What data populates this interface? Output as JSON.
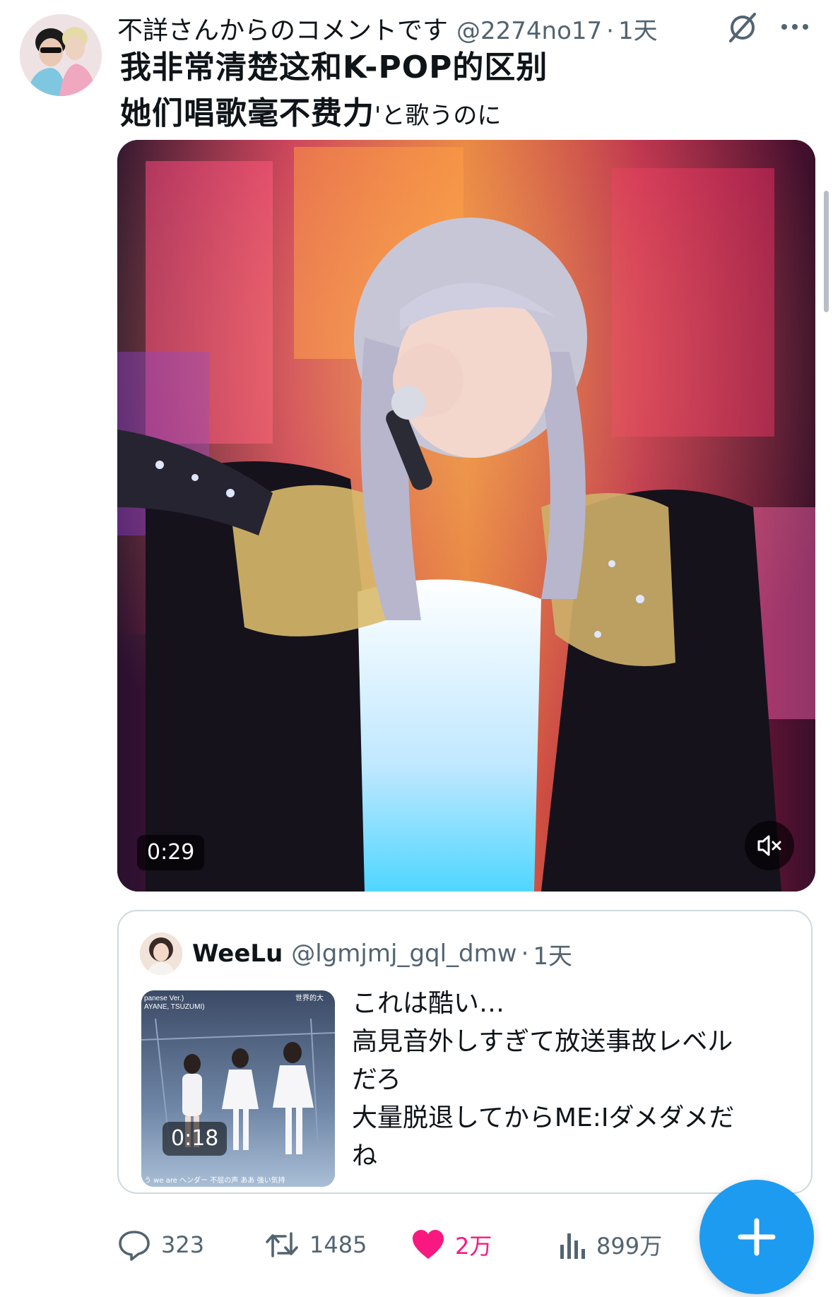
{
  "tweet": {
    "author_name": "不詳さんからのコメントです",
    "handle": "@2274no17",
    "separator": "·",
    "time": "1天",
    "text_line1": "我非常清楚这和K-POP的区别",
    "text_line2": "她们唱歌毫不费力",
    "text_line2_suffix": "'と歌うのに",
    "video": {
      "duration": "0:29",
      "muted": true
    }
  },
  "quote": {
    "author_name": "WeeLu",
    "handle": "@lgmjmj_gql_dmw",
    "separator": "·",
    "time": "1天",
    "thumbnail_duration": "0:18",
    "thumbnail_caption_left": "panese Ver.)",
    "thumbnail_caption_left2": "AYANE, TSUZUMI)",
    "thumbnail_caption_right": "世界的大",
    "thumbnail_subtitle": "う we are ヘンダー 不屈の声 ああ 強い気持",
    "text_lines": [
      "これは酷い…",
      "高見音外しすぎて放送事故レベル",
      "だろ",
      "大量脱退してからME:Iダメダメだ",
      "ね"
    ]
  },
  "actions": {
    "replies": "323",
    "retweets": "1485",
    "likes": "2万",
    "views": "899万"
  },
  "colors": {
    "accent": "#1d9bf0",
    "like": "#f91880",
    "secondary_text": "#536471",
    "border": "#cfd9de"
  },
  "icons": [
    "grok-icon",
    "more-icon",
    "mute-icon",
    "reply-icon",
    "retweet-icon",
    "like-icon",
    "views-icon",
    "compose-icon"
  ]
}
